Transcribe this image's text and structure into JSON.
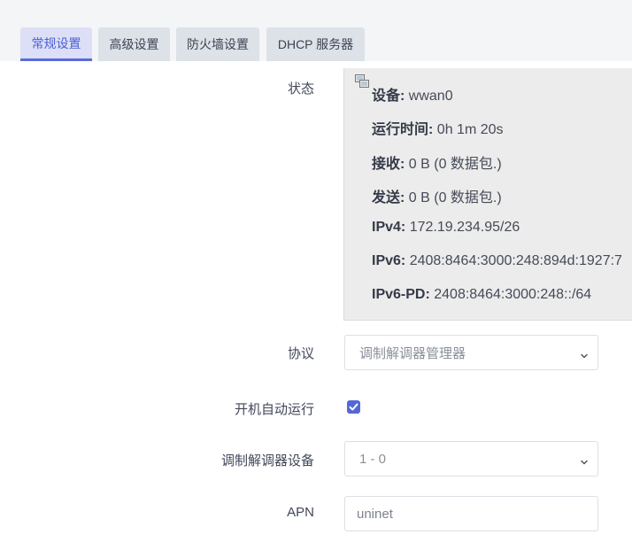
{
  "tabs": [
    {
      "label": "常规设置",
      "active": true
    },
    {
      "label": "高级设置",
      "active": false
    },
    {
      "label": "防火墙设置",
      "active": false
    },
    {
      "label": "DHCP 服务器",
      "active": false
    }
  ],
  "form": {
    "status_label": "状态",
    "status": {
      "device_label": "设备:",
      "device_value": "wwan0",
      "uptime_label": "运行时间:",
      "uptime_value": "0h 1m 20s",
      "rx_label": "接收:",
      "rx_value": "0 B (0 数据包.)",
      "tx_label": "发送:",
      "tx_value": "0 B (0 数据包.)",
      "ipv4_label": "IPv4:",
      "ipv4_value": "172.19.234.95/26",
      "ipv6_label": "IPv6:",
      "ipv6_value": "2408:8464:3000:248:894d:1927:7",
      "ipv6pd_label": "IPv6-PD:",
      "ipv6pd_value": "2408:8464:3000:248::/64"
    },
    "protocol_label": "协议",
    "protocol_value": "调制解调器管理器",
    "autostart_label": "开机自动运行",
    "autostart_checked": true,
    "modem_device_label": "调制解调器设备",
    "modem_device_value": "1 - 0",
    "apn_label": "APN",
    "apn_value": "uninet"
  },
  "colors": {
    "accent": "#5467d8",
    "active_tab_bg": "#dcdff6",
    "tab_bg": "#dde1e8",
    "status_bg": "#ececec"
  },
  "icons": {
    "status": "network-interface-icon",
    "dropdown": "chevron-down-icon",
    "checkbox": "checkmark-icon"
  }
}
